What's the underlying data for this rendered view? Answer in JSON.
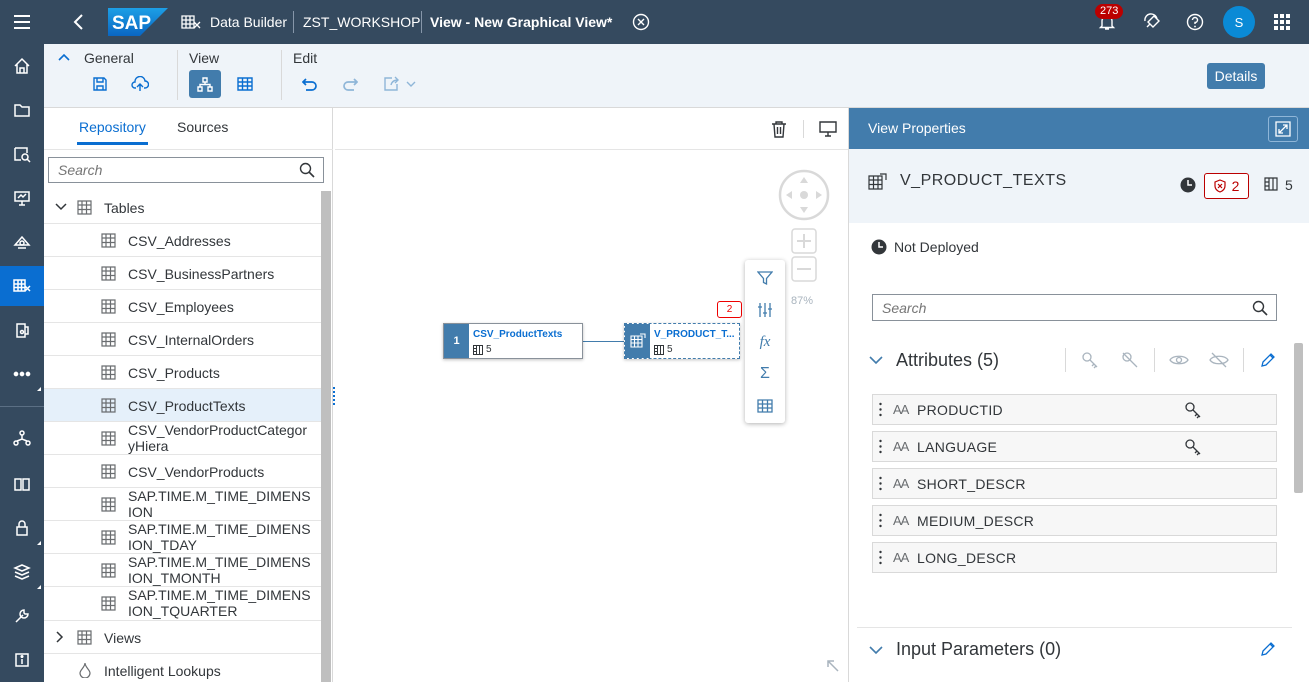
{
  "shell": {
    "brand": "SAP",
    "app_title": "Data Builder",
    "space": "ZST_WORKSHOP",
    "tab_title": "View - New Graphical View",
    "unsaved_marker": "*",
    "notification_count": "273",
    "user_initial": "S"
  },
  "left_nav": {
    "items": [
      "home-icon",
      "folder-icon",
      "data-access-icon",
      "presentation-icon",
      "data-warehouse-icon",
      "data-builder-icon",
      "business-builder-icon",
      "more-icon",
      "connections-icon",
      "catalog-icon",
      "security-icon",
      "transport-icon",
      "tools-icon",
      "info-icon"
    ],
    "active_index": 5
  },
  "toolbar": {
    "general_label": "General",
    "view_label": "View",
    "edit_label": "Edit",
    "details_label": "Details"
  },
  "repo": {
    "tabs": [
      "Repository",
      "Sources"
    ],
    "active_tab": 0,
    "search_placeholder": "Search",
    "tables_label": "Tables",
    "tables": [
      "CSV_Addresses",
      "CSV_BusinessPartners",
      "CSV_Employees",
      "CSV_InternalOrders",
      "CSV_Products",
      "CSV_ProductTexts",
      "CSV_VendorProductCategor yHiera",
      "CSV_VendorProducts",
      "SAP.TIME.M_TIME_DIMENS ION",
      "SAP.TIME.M_TIME_DIMENS ION_TDAY",
      "SAP.TIME.M_TIME_DIMENS ION_TMONTH",
      "SAP.TIME.M_TIME_DIMENS ION_TQUARTER"
    ],
    "selected_table": "CSV_ProductTexts",
    "views_label": "Views",
    "lookups_label": "Intelligent Lookups"
  },
  "canvas": {
    "zoom": "87%",
    "source_node": {
      "index": "1",
      "title": "CSV_ProductTexts",
      "columns": "5"
    },
    "output_node": {
      "title": "V_PRODUCT_T...",
      "columns": "5",
      "errors": "2"
    }
  },
  "props": {
    "header": "View Properties",
    "object_name": "V_PRODUCT_TEXTS",
    "error_count": "2",
    "column_count": "5",
    "status": "Not Deployed",
    "search_placeholder": "Search",
    "attributes_title": "Attributes (5)",
    "attributes": [
      {
        "name": "PRODUCTID",
        "key": true
      },
      {
        "name": "LANGUAGE",
        "key": true
      },
      {
        "name": "SHORT_DESCR",
        "key": false
      },
      {
        "name": "MEDIUM_DESCR",
        "key": false
      },
      {
        "name": "LONG_DESCR",
        "key": false
      }
    ],
    "input_params_title": "Input Parameters (0)"
  },
  "colors": {
    "shell": "#354a5f",
    "accent": "#0a6ed1",
    "header_blue": "#427cac",
    "error": "#bb0000"
  }
}
